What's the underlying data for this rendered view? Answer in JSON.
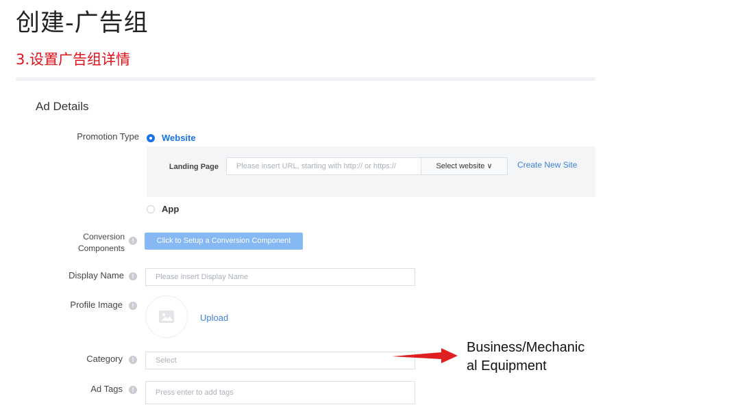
{
  "slide": {
    "title": "创建-广告组",
    "subtitle": "3.设置广告组详情",
    "annotation": "Business/Mechanical Equipment",
    "annotation_line1": "Business/Mechanic",
    "annotation_line2": "al Equipment"
  },
  "ad_details": {
    "section_title": "Ad Details",
    "promotion_type": {
      "label": "Promotion Type",
      "options": [
        {
          "label": "Website",
          "selected": true
        },
        {
          "label": "App",
          "selected": false
        }
      ],
      "landing_page": {
        "label": "Landing Page",
        "placeholder": "Please insert URL, starting with http:// or https://",
        "select_label": "Select website ∨",
        "create_link": "Create New Site"
      }
    },
    "conversion": {
      "label_line1": "Conversion",
      "label_line2": "Components",
      "button": "Click to Setup a Conversion Component"
    },
    "display_name": {
      "label": "Display Name",
      "placeholder": "Please insert Display Name"
    },
    "profile_image": {
      "label": "Profile Image",
      "upload": "Upload"
    },
    "category": {
      "label": "Category",
      "placeholder": "Select"
    },
    "ad_tags": {
      "label": "Ad Tags",
      "placeholder": "Press enter to add tags"
    }
  },
  "colors": {
    "subtitle": "#e0111a",
    "accent": "#1a73e8",
    "button": "#86b9f3",
    "arrow": "#e02020"
  },
  "icons": [
    "info-icon",
    "image-placeholder-icon",
    "chevron-down-icon",
    "arrow-right-icon"
  ]
}
